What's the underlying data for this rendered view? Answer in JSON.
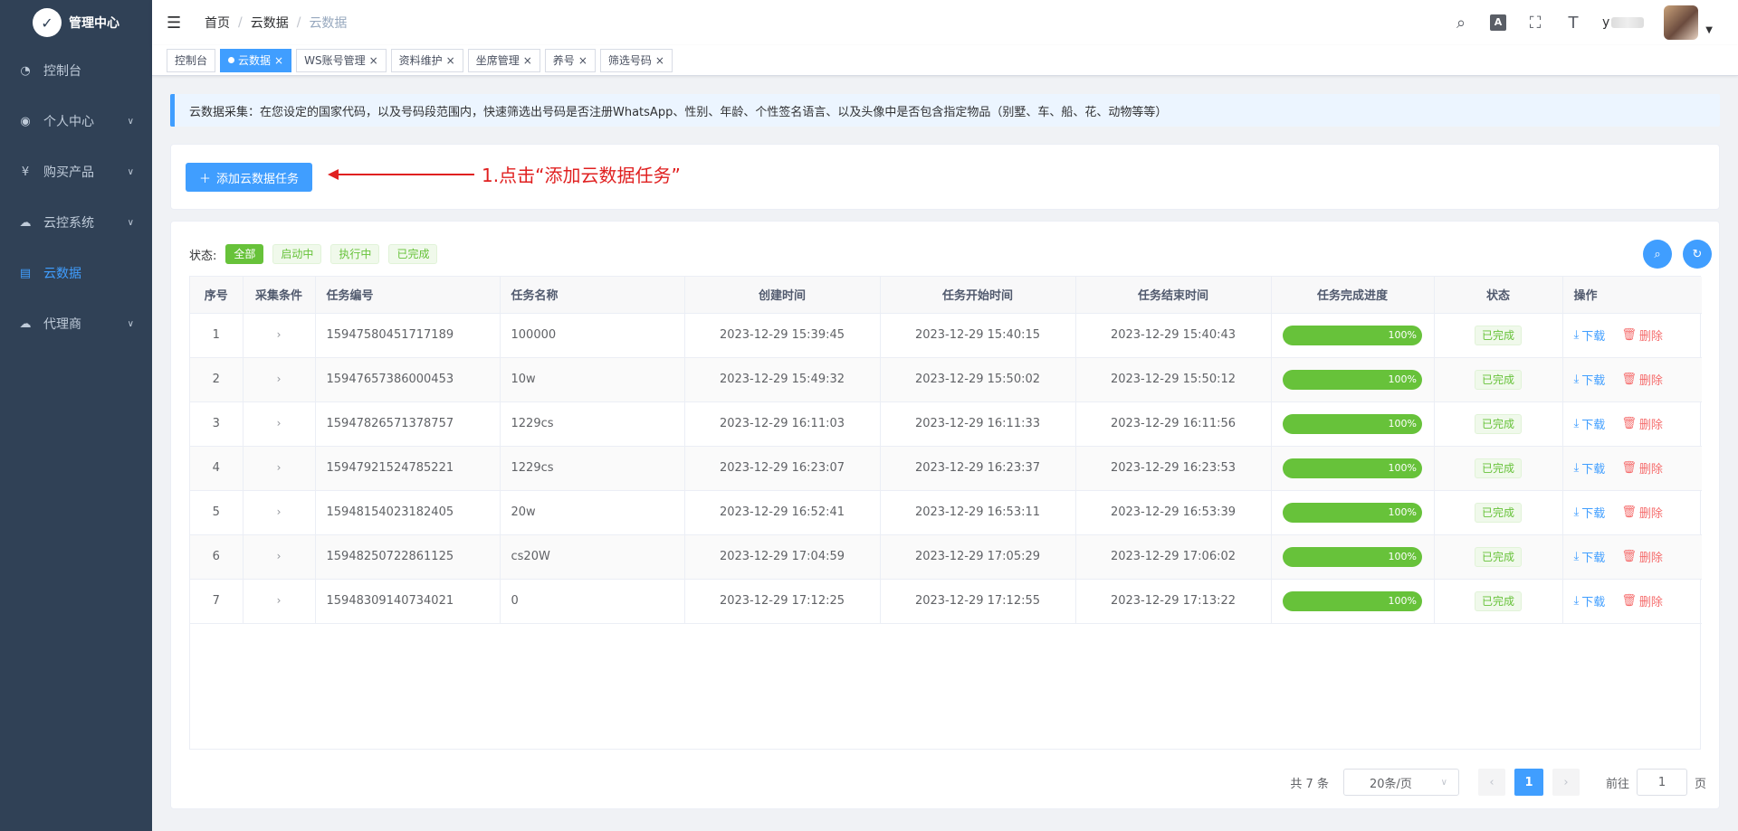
{
  "app": {
    "title": "管理中心"
  },
  "sidebar": {
    "items": [
      {
        "label": "控制台",
        "icon": "dashboard-icon",
        "expandable": false
      },
      {
        "label": "个人中心",
        "icon": "user-icon",
        "expandable": true
      },
      {
        "label": "购买产品",
        "icon": "yen-icon",
        "expandable": true
      },
      {
        "label": "云控系统",
        "icon": "cloud-icon",
        "expandable": true
      },
      {
        "label": "云数据",
        "icon": "document-icon",
        "expandable": false,
        "active": true
      },
      {
        "label": "代理商",
        "icon": "cloud-icon",
        "expandable": true
      }
    ]
  },
  "header": {
    "breadcrumb": [
      "首页",
      "云数据",
      "云数据"
    ],
    "username": "y"
  },
  "tabs": [
    {
      "label": "控制台",
      "active": false,
      "closable": false
    },
    {
      "label": "云数据",
      "active": true,
      "closable": true
    },
    {
      "label": "WS账号管理",
      "active": false,
      "closable": true
    },
    {
      "label": "资料维护",
      "active": false,
      "closable": true
    },
    {
      "label": "坐席管理",
      "active": false,
      "closable": true
    },
    {
      "label": "养号",
      "active": false,
      "closable": true
    },
    {
      "label": "筛选号码",
      "active": false,
      "closable": true
    }
  ],
  "notice": "云数据采集：在您设定的国家代码，以及号码段范围内，快速筛选出号码是否注册WhatsApp、性别、年龄、个性签名语言、以及头像中是否包含指定物品（别墅、车、船、花、动物等等）",
  "toolbar": {
    "add_label": "添加云数据任务",
    "annotation": "1.点击“添加云数据任务”"
  },
  "filter": {
    "label": "状态:",
    "options": [
      {
        "label": "全部",
        "active": true
      },
      {
        "label": "启动中",
        "active": false
      },
      {
        "label": "执行中",
        "active": false
      },
      {
        "label": "已完成",
        "active": false
      }
    ]
  },
  "table": {
    "columns": [
      "序号",
      "采集条件",
      "任务编号",
      "任务名称",
      "创建时间",
      "任务开始时间",
      "任务结束时间",
      "任务完成进度",
      "状态",
      "操作"
    ],
    "download_label": "下载",
    "delete_label": "删除",
    "rows": [
      {
        "index": "1",
        "task_id": "15947580451717189",
        "name": "100000",
        "created": "2023-12-29 15:39:45",
        "start": "2023-12-29 15:40:15",
        "end": "2023-12-29 15:40:43",
        "progress": "100%",
        "status": "已完成"
      },
      {
        "index": "2",
        "task_id": "15947657386000453",
        "name": "10w",
        "created": "2023-12-29 15:49:32",
        "start": "2023-12-29 15:50:02",
        "end": "2023-12-29 15:50:12",
        "progress": "100%",
        "status": "已完成"
      },
      {
        "index": "3",
        "task_id": "15947826571378757",
        "name": "1229cs",
        "created": "2023-12-29 16:11:03",
        "start": "2023-12-29 16:11:33",
        "end": "2023-12-29 16:11:56",
        "progress": "100%",
        "status": "已完成"
      },
      {
        "index": "4",
        "task_id": "15947921524785221",
        "name": "1229cs",
        "created": "2023-12-29 16:23:07",
        "start": "2023-12-29 16:23:37",
        "end": "2023-12-29 16:23:53",
        "progress": "100%",
        "status": "已完成"
      },
      {
        "index": "5",
        "task_id": "15948154023182405",
        "name": "20w",
        "created": "2023-12-29 16:52:41",
        "start": "2023-12-29 16:53:11",
        "end": "2023-12-29 16:53:39",
        "progress": "100%",
        "status": "已完成"
      },
      {
        "index": "6",
        "task_id": "15948250722861125",
        "name": "cs20W",
        "created": "2023-12-29 17:04:59",
        "start": "2023-12-29 17:05:29",
        "end": "2023-12-29 17:06:02",
        "progress": "100%",
        "status": "已完成"
      },
      {
        "index": "7",
        "task_id": "15948309140734021",
        "name": "0",
        "created": "2023-12-29 17:12:25",
        "start": "2023-12-29 17:12:55",
        "end": "2023-12-29 17:13:22",
        "progress": "100%",
        "status": "已完成"
      }
    ]
  },
  "pagination": {
    "total": "共 7 条",
    "page_size": "20条/页",
    "current_page": "1",
    "goto_prefix": "前往",
    "goto_value": "1",
    "goto_suffix": "页"
  },
  "colors": {
    "primary": "#409eff",
    "success": "#67c23a",
    "danger": "#f56c6c",
    "sidebar": "#304156",
    "annotation": "#e02020"
  }
}
